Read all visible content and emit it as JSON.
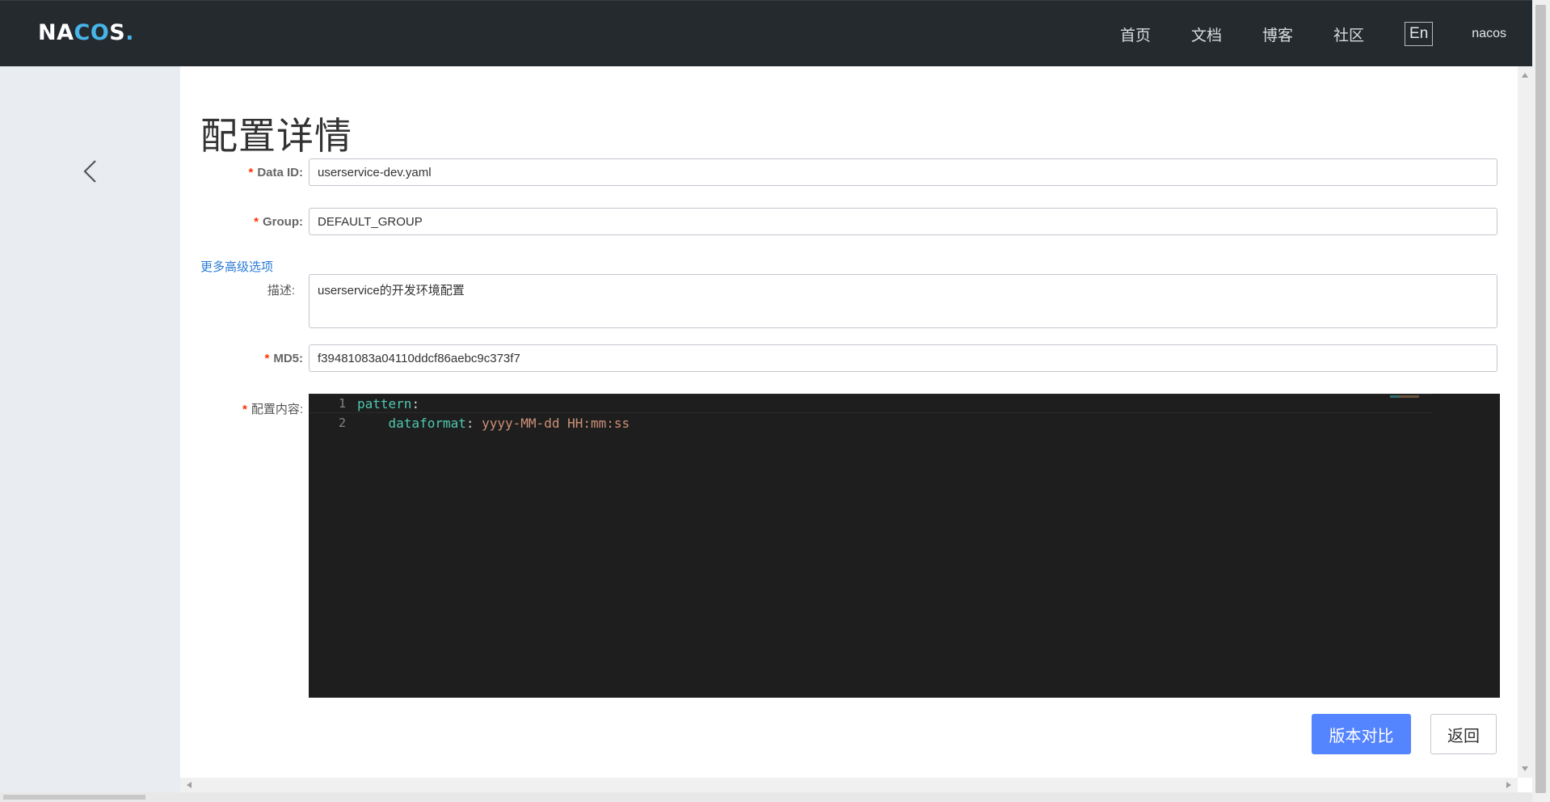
{
  "header": {
    "logo_prefix": "NA",
    "logo_mid": "CO",
    "logo_suffix": "S",
    "logo_dot": ".",
    "nav": [
      "首页",
      "文档",
      "博客",
      "社区"
    ],
    "lang": "En",
    "user": "nacos"
  },
  "page": {
    "title": "配置详情",
    "advanced_link": "更多高级选项"
  },
  "form": {
    "data_id": {
      "label": "Data ID:",
      "value": "userservice-dev.yaml"
    },
    "group": {
      "label": "Group:",
      "value": "DEFAULT_GROUP"
    },
    "description": {
      "label": "描述:",
      "value": "userservice的开发环境配置"
    },
    "md5": {
      "label": "MD5:",
      "value": "f39481083a04110ddcf86aebc9c373f7"
    },
    "content": {
      "label": "配置内容:"
    },
    "required_mark": "*"
  },
  "editor": {
    "lines": [
      {
        "num": "1",
        "indent": "",
        "key": "pattern",
        "sep": ":",
        "value": ""
      },
      {
        "num": "2",
        "indent": "    ",
        "key": "dataformat",
        "sep": ": ",
        "value": "yyyy-MM-dd HH:mm:ss"
      }
    ]
  },
  "actions": {
    "compare": "版本对比",
    "back": "返回"
  },
  "colors": {
    "header_bg": "#252a2f",
    "primary": "#5584ff",
    "required": "#ff3000",
    "link": "#2a7bd5",
    "editor_bg": "#1e1e1e"
  }
}
